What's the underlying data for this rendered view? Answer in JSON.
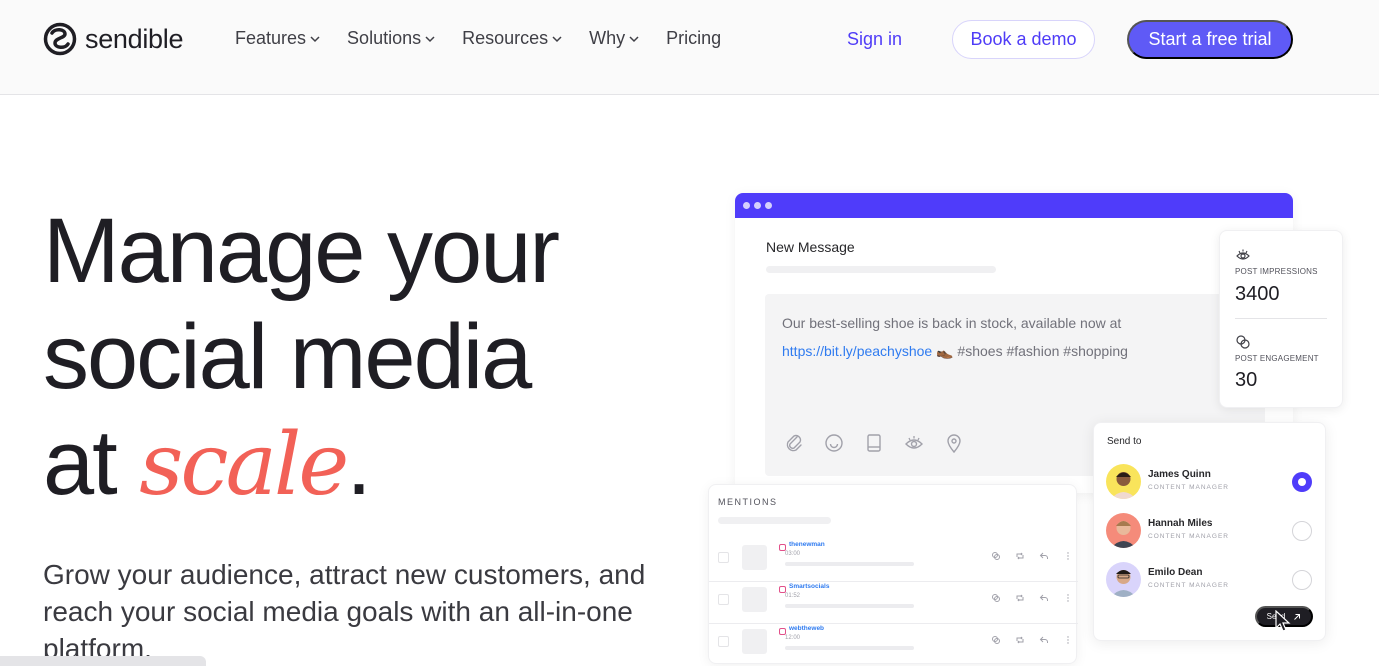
{
  "nav": {
    "brand": "sendible",
    "links": [
      {
        "label": "Features",
        "dropdown": true
      },
      {
        "label": "Solutions",
        "dropdown": true
      },
      {
        "label": "Resources",
        "dropdown": true
      },
      {
        "label": "Why",
        "dropdown": true
      },
      {
        "label": "Pricing",
        "dropdown": false
      }
    ],
    "signin": "Sign in",
    "demo": "Book a demo",
    "trial": "Start a free trial"
  },
  "hero": {
    "line1": "Manage your",
    "line2": "social media",
    "line3_prefix": "at ",
    "line3_accent": "scale",
    "line3_suffix": ".",
    "subhead": "Grow your audience, attract new customers, and reach your social media goals with an all-in-one platform."
  },
  "composer": {
    "title": "New Message",
    "message_text": "Our best-selling shoe is back in stock, available now at",
    "message_link": "https://bit.ly/peachyshoe",
    "message_emoji": "👞",
    "message_tags": "#shoes #fashion #shopping",
    "tools": [
      "paperclip-icon",
      "emoji-icon",
      "book-icon",
      "eye-icon",
      "location-icon"
    ]
  },
  "stats": {
    "impressions_label": "POST IMPRESSIONS",
    "impressions_value": "3400",
    "engagement_label": "POST ENGAGEMENT",
    "engagement_value": "30"
  },
  "mentions": {
    "title": "MENTIONS",
    "items": [
      {
        "name": "thenewman",
        "time": "03:00"
      },
      {
        "name": "Smartsocials",
        "time": "01:52"
      },
      {
        "name": "webtheweb",
        "time": "12:00"
      }
    ]
  },
  "sendto": {
    "title": "Send to",
    "people": [
      {
        "name": "James Quinn",
        "role": "CONTENT MANAGER",
        "selected": true,
        "color": "#f9e45b"
      },
      {
        "name": "Hannah Miles",
        "role": "CONTENT MANAGER",
        "selected": false,
        "color": "#f58b7a"
      },
      {
        "name": "Emilo Dean",
        "role": "CONTENT MANAGER",
        "selected": false,
        "color": "#d9d4fb"
      }
    ],
    "send_label": "Send"
  },
  "colors": {
    "brand": "#4f3cfa",
    "accent": "#f26157",
    "link": "#2f7bf0"
  }
}
